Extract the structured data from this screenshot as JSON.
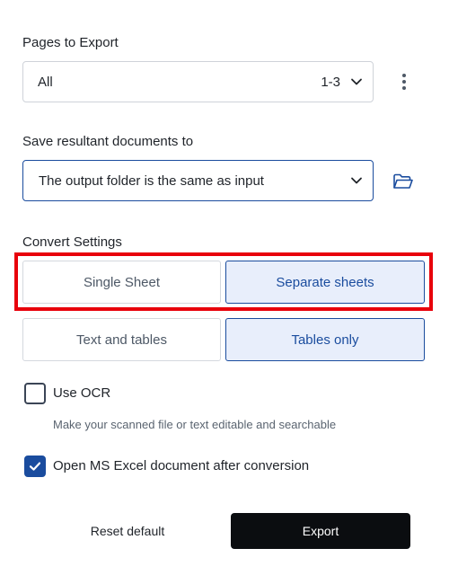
{
  "pages_section": {
    "label": "Pages to Export",
    "selected": "All",
    "range": "1-3",
    "icon": "chevron-down-icon",
    "more_icon": "more-vertical-icon"
  },
  "save_section": {
    "label": "Save resultant documents to",
    "selected": "The output folder is the same as input",
    "icon": "chevron-down-icon",
    "folder_icon": "folder-open-icon"
  },
  "convert_section": {
    "label": "Convert Settings",
    "sheet_options": [
      {
        "label": "Single Sheet",
        "selected": false
      },
      {
        "label": "Separate sheets",
        "selected": true
      }
    ],
    "content_options": [
      {
        "label": "Text and tables",
        "selected": false
      },
      {
        "label": "Tables only",
        "selected": true
      }
    ]
  },
  "ocr": {
    "label": "Use OCR",
    "checked": false,
    "hint": "Make your scanned file or text editable and searchable"
  },
  "open_excel": {
    "label": "Open MS Excel document after conversion",
    "checked": true
  },
  "footer": {
    "reset_label": "Reset default",
    "export_label": "Export"
  },
  "colors": {
    "accent": "#1a4c9e",
    "selected_bg": "#e8eefb",
    "highlight": "#e8000b",
    "export_bg": "#0b0d10"
  }
}
